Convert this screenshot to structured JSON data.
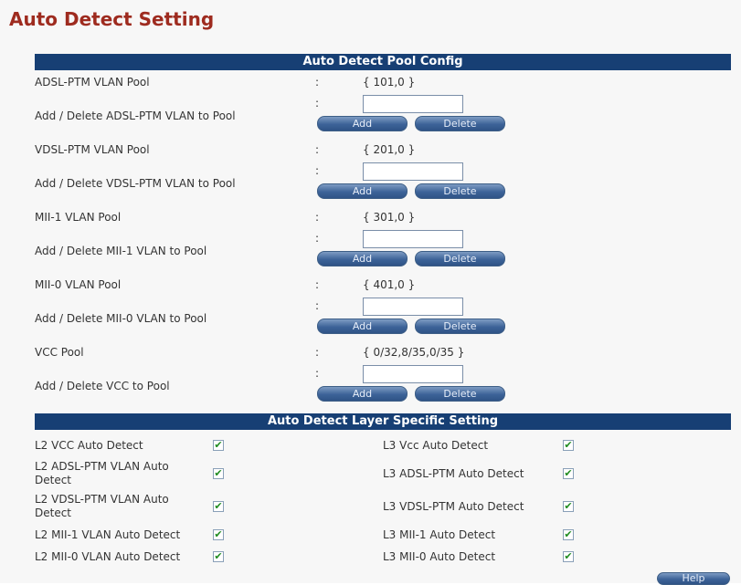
{
  "page": {
    "title": "Auto Detect Setting"
  },
  "pool_config": {
    "header": "Auto Detect Pool Config",
    "colon": ":",
    "add_label": "Add",
    "delete_label": "Delete",
    "rows": [
      {
        "label": "ADSL-PTM VLAN Pool",
        "value": "{ 101,0 }",
        "edit_label": "Add / Delete ADSL-PTM VLAN to Pool",
        "input_value": ""
      },
      {
        "label": "VDSL-PTM VLAN Pool",
        "value": "{ 201,0 }",
        "edit_label": "Add / Delete VDSL-PTM VLAN to Pool",
        "input_value": ""
      },
      {
        "label": "MII-1 VLAN Pool",
        "value": "{ 301,0 }",
        "edit_label": "Add / Delete MII-1 VLAN to Pool",
        "input_value": ""
      },
      {
        "label": "MII-0 VLAN Pool",
        "value": "{ 401,0 }",
        "edit_label": "Add / Delete MII-0 VLAN to Pool",
        "input_value": ""
      },
      {
        "label": "VCC Pool",
        "value": "{ 0/32,8/35,0/35 }",
        "edit_label": "Add / Delete VCC to Pool",
        "input_value": ""
      }
    ]
  },
  "layer_specific": {
    "header": "Auto Detect Layer Specific Setting",
    "checked_glyph": "✔",
    "rows": [
      {
        "l2_label": "L2 VCC Auto Detect",
        "l2_checked": true,
        "l3_label": "L3 Vcc Auto Detect",
        "l3_checked": true
      },
      {
        "l2_label": "L2 ADSL-PTM VLAN Auto Detect",
        "l2_checked": true,
        "l3_label": "L3 ADSL-PTM Auto Detect",
        "l3_checked": true
      },
      {
        "l2_label": "L2 VDSL-PTM VLAN Auto Detect",
        "l2_checked": true,
        "l3_label": "L3 VDSL-PTM Auto Detect",
        "l3_checked": true
      },
      {
        "l2_label": "L2 MII-1 VLAN Auto Detect",
        "l2_checked": true,
        "l3_label": "L3 MII-1 Auto Detect",
        "l3_checked": true
      },
      {
        "l2_label": "L2 MII-0 VLAN Auto Detect",
        "l2_checked": true,
        "l3_label": "L3 MII-0 Auto Detect",
        "l3_checked": true
      }
    ]
  },
  "help": {
    "label": "Help"
  },
  "colors": {
    "title": "#9e2b1f",
    "band": "#173f74",
    "button": "#3d6398",
    "check": "#1f8b1f"
  }
}
